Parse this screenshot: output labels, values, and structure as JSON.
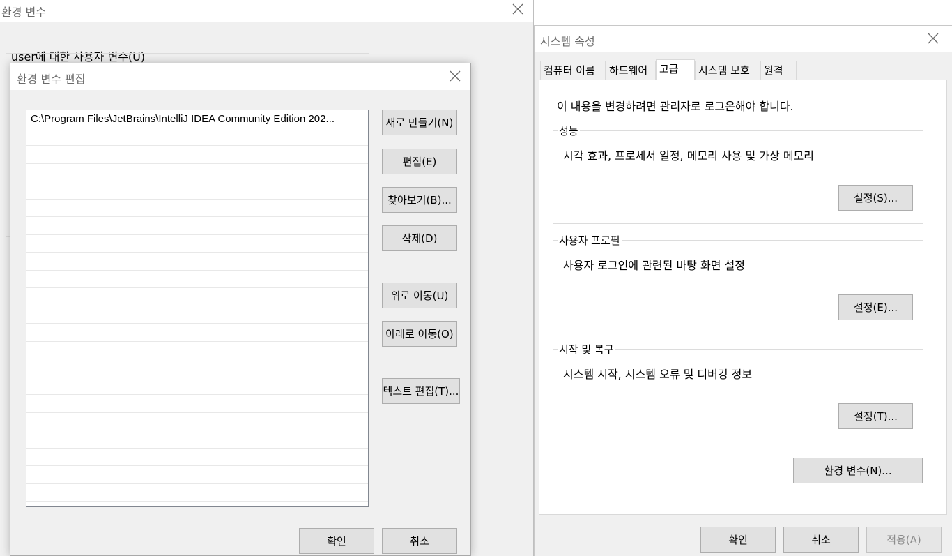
{
  "env_window": {
    "title": "환경 변수",
    "user_vars_label": "user에 대한 사용자 변수(U)"
  },
  "edit_dialog": {
    "title": "환경 변수 편집",
    "paths": [
      "C:\\Program Files\\JetBrains\\IntelliJ IDEA Community Edition 202..."
    ],
    "empty_rows": 21,
    "buttons": {
      "new": "새로 만들기(N)",
      "edit": "편집(E)",
      "browse": "찾아보기(B)...",
      "delete": "삭제(D)",
      "move_up": "위로 이동(U)",
      "move_down": "아래로 이동(O)",
      "edit_text": "텍스트 편집(T)..."
    },
    "ok": "확인",
    "cancel": "취소"
  },
  "system_properties": {
    "title": "시스템 속성",
    "tabs": [
      {
        "label": "컴퓨터 이름",
        "active": false
      },
      {
        "label": "하드웨어",
        "active": false
      },
      {
        "label": "고급",
        "active": true
      },
      {
        "label": "시스템 보호",
        "active": false
      },
      {
        "label": "원격",
        "active": false
      }
    ],
    "admin_note": "이 내용을 변경하려면 관리자로 로그온해야 합니다.",
    "performance": {
      "label": "성능",
      "description": "시각 효과, 프로세서 일정, 메모리 사용 및 가상 메모리",
      "button": "설정(S)..."
    },
    "user_profiles": {
      "label": "사용자 프로필",
      "description": "사용자 로그인에 관련된 바탕 화면 설정",
      "button": "설정(E)..."
    },
    "startup_recovery": {
      "label": "시작 및 복구",
      "description": "시스템 시작, 시스템 오류 및 디버깅 정보",
      "button": "설정(T)..."
    },
    "env_vars_button": "환경 변수(N)...",
    "ok": "확인",
    "cancel": "취소",
    "apply": "적용(A)"
  }
}
